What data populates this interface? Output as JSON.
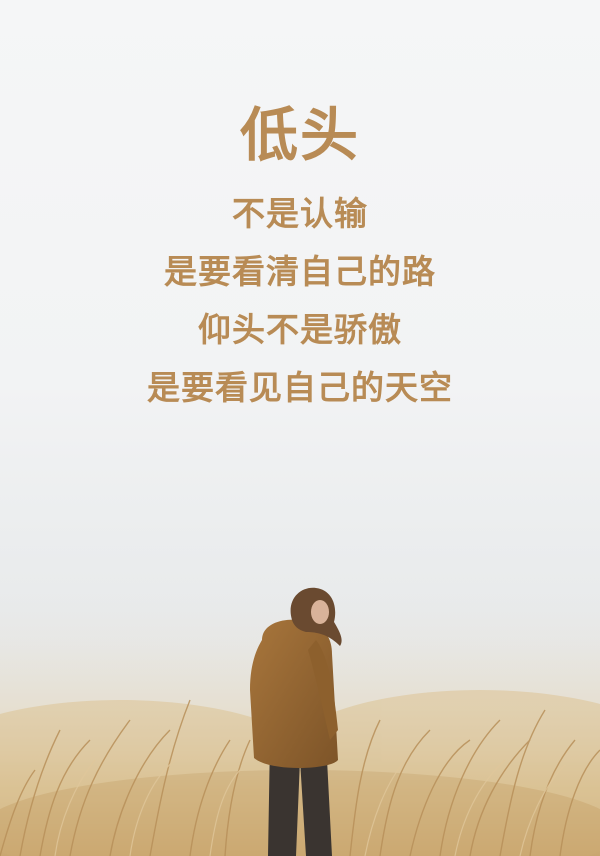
{
  "poster": {
    "title": "低头",
    "lines": [
      "不是认输",
      "是要看清自己的路",
      "仰头不是骄傲",
      "是要看见自己的天空"
    ],
    "colors": {
      "text": "#b88b55",
      "background": "#f3f4f5",
      "grass": "#c9a66b",
      "coat": "#9b6b33"
    }
  }
}
